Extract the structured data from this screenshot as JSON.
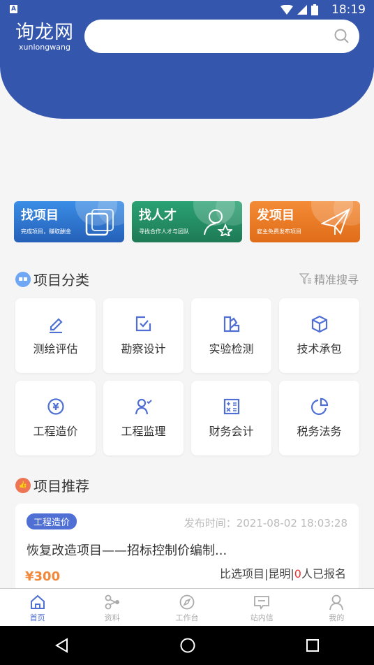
{
  "status": {
    "time": "18:19",
    "notification_icon": "A"
  },
  "header": {
    "logo_cn": "询龙网",
    "logo_en": "xunlongwang",
    "search_placeholder": ""
  },
  "banners": [
    {
      "title": "找项目",
      "subtitle": "完成项目，赚取酬金",
      "color": "#2f76d0"
    },
    {
      "title": "找人才",
      "subtitle": "寻找合作人才与团队",
      "color": "#249066"
    },
    {
      "title": "发项目",
      "subtitle": "雇主免费发布项目",
      "color": "#ec7a25"
    }
  ],
  "categories": {
    "title": "项目分类",
    "more": "精准搜寻",
    "items": [
      {
        "label": "测绘评估",
        "icon": "pencil-icon"
      },
      {
        "label": "勘察设计",
        "icon": "checkbox-icon"
      },
      {
        "label": "实验检测",
        "icon": "palette-icon"
      },
      {
        "label": "技术承包",
        "icon": "cube-icon"
      },
      {
        "label": "工程造价",
        "icon": "yen-icon"
      },
      {
        "label": "工程监理",
        "icon": "user-check-icon"
      },
      {
        "label": "财务会计",
        "icon": "calculator-icon"
      },
      {
        "label": "税务法务",
        "icon": "pie-chart-icon"
      }
    ]
  },
  "recommend": {
    "title": "项目推荐",
    "item": {
      "tag": "工程造价",
      "published": "发布时间：2021-08-02 18:03:28",
      "title": "恢复改造项目——招标控制价编制...",
      "price": "¥300",
      "type": "比选项目",
      "city": "昆明",
      "count": "0",
      "count_suffix": "人已报名",
      "sep": "|"
    }
  },
  "tabs": [
    {
      "label": "首页",
      "active": true
    },
    {
      "label": "资料"
    },
    {
      "label": "工作台"
    },
    {
      "label": "站内信"
    },
    {
      "label": "我的"
    }
  ],
  "colors": {
    "primary": "#3456ad",
    "accent": "#4f6fd4",
    "price": "#f0893c"
  }
}
